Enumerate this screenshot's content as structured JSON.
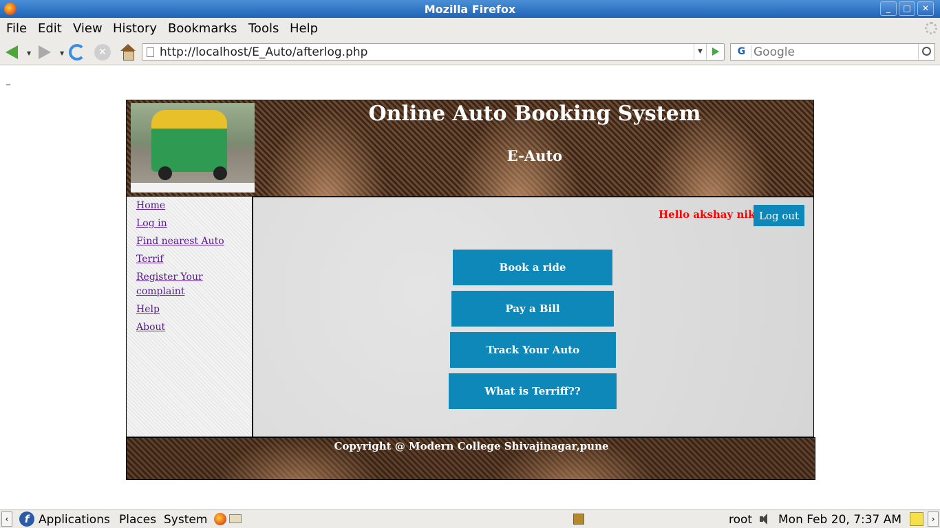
{
  "window": {
    "title": "Mozilla Firefox",
    "controls": [
      "_",
      "□",
      "✕"
    ]
  },
  "menubar": {
    "items": [
      {
        "label": "File"
      },
      {
        "label": "Edit"
      },
      {
        "label": "View"
      },
      {
        "label": "History"
      },
      {
        "label": "Bookmarks"
      },
      {
        "label": "Tools"
      },
      {
        "label": "Help"
      }
    ]
  },
  "navbar": {
    "url": "http://localhost/E_Auto/afterlog.php",
    "search_engine": "G",
    "search_placeholder": "Google"
  },
  "page": {
    "dash": "_",
    "title": "Online Auto Booking System",
    "subtitle": "E-Auto",
    "sidebar_links": [
      {
        "label": "Home"
      },
      {
        "label": "Log in"
      },
      {
        "label": "Find nearest Auto"
      },
      {
        "label": "Terrif"
      },
      {
        "label": "Register Your complaint"
      },
      {
        "label": "Help"
      },
      {
        "label": "About"
      }
    ],
    "greeting": "Hello akshay nikam",
    "logout_label": "Log out",
    "actions": [
      {
        "label": "Book a ride"
      },
      {
        "label": "Pay a Bill"
      },
      {
        "label": "Track Your Auto"
      },
      {
        "label": "What is Terriff??"
      }
    ],
    "footer": "Copyright @ Modern College Shivajinagar,pune",
    "accent_color": "#0e88b8",
    "greeting_color": "#ff0000"
  },
  "taskbar": {
    "applications": "Applications",
    "places": "Places",
    "system": "System",
    "user": "root",
    "clock": "Mon Feb 20,  7:37 AM"
  }
}
